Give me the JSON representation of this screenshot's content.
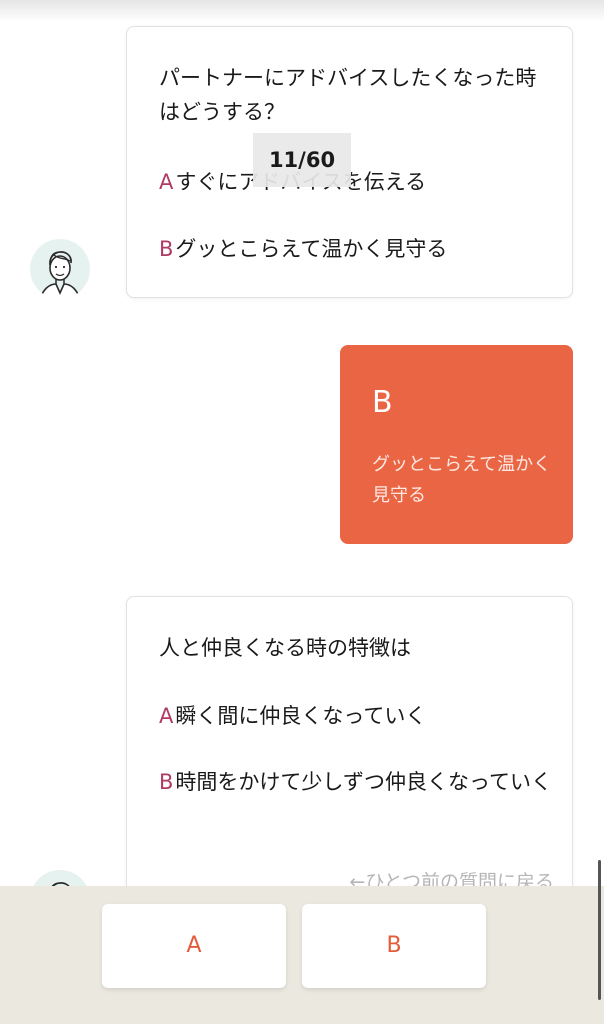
{
  "questions": [
    {
      "text": "パートナーにアドバイスしたくなった時はどうする？",
      "options": [
        {
          "letter": "A",
          "text": "すぐにアドバイスを伝える"
        },
        {
          "letter": "B",
          "text": "グッとこらえて温かく見守る"
        }
      ]
    },
    {
      "text": "人と仲良くなる時の特徴は",
      "options": [
        {
          "letter": "A",
          "text": "瞬く間に仲良くなっていく"
        },
        {
          "letter": "B",
          "text": "時間をかけて少しずつ仲良くなっていく"
        }
      ],
      "back_link": "←ひとつ前の質問に戻る"
    }
  ],
  "progress": {
    "label": "11/60",
    "current": 11,
    "total": 60
  },
  "answer": {
    "letter": "B",
    "text": "グッとこらえて温かく見守る"
  },
  "choices": {
    "a_label": "A",
    "b_label": "B"
  },
  "colors": {
    "accent": "#ea6544",
    "option_letter": "#b03a64",
    "bottom_bar": "#ebe8e0"
  },
  "icons": {
    "avatar": "advisor-avatar-icon"
  }
}
